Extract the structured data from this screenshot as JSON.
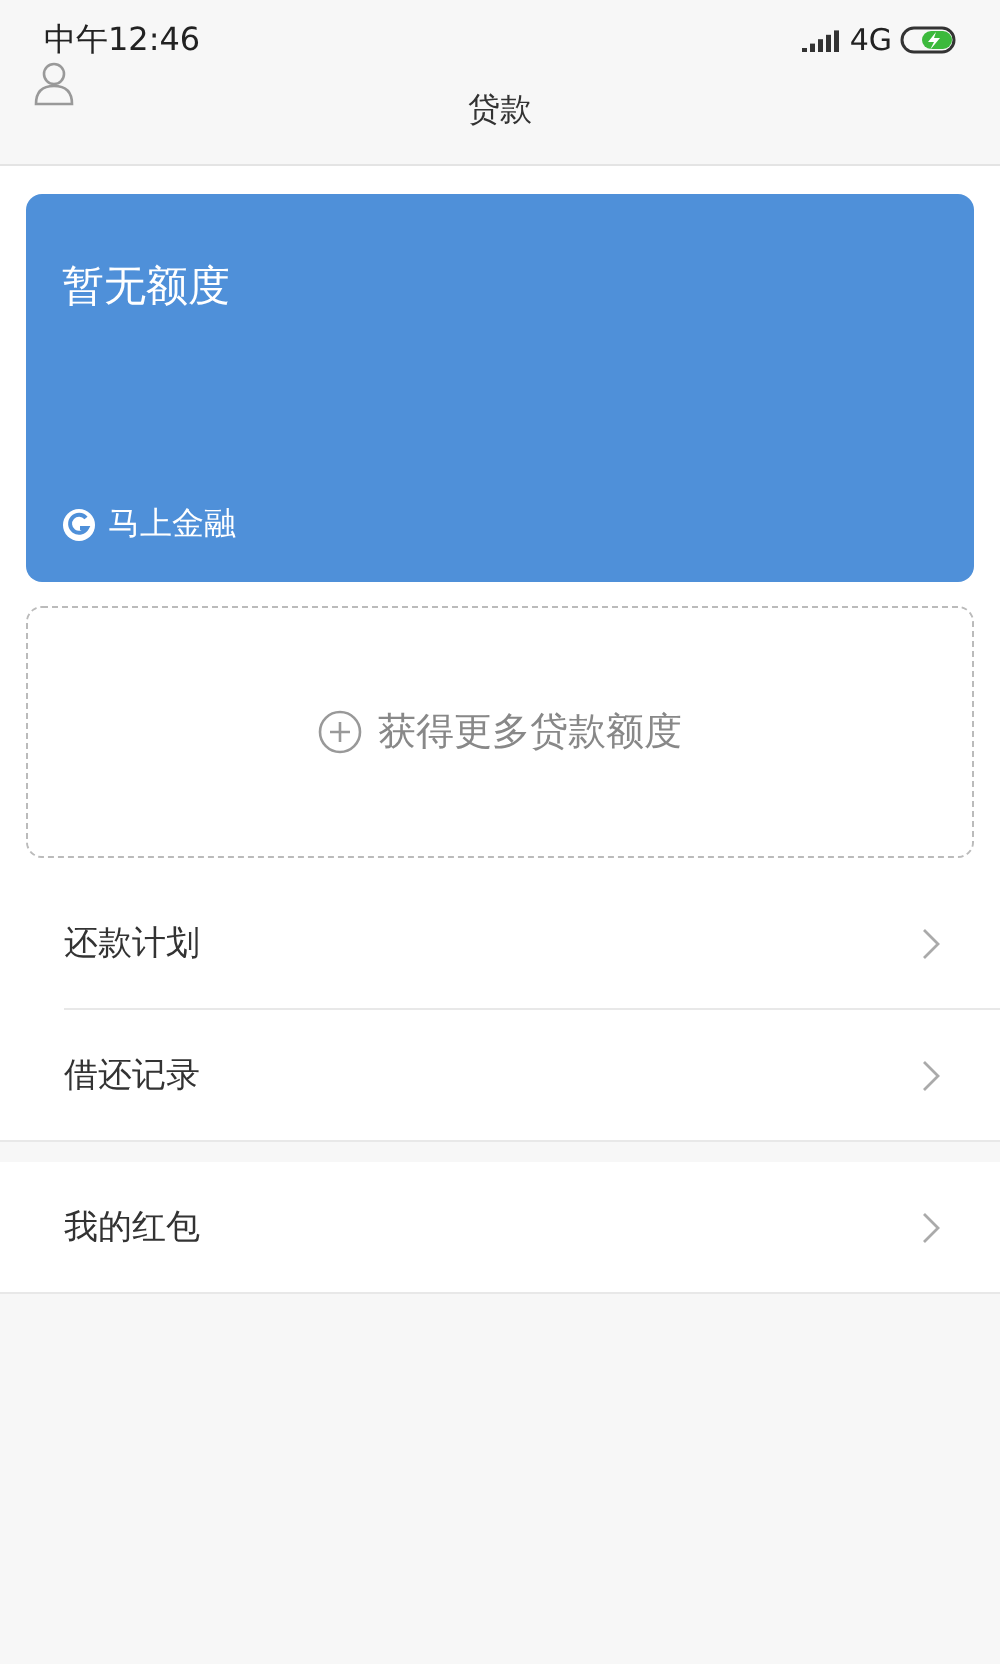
{
  "status_bar": {
    "time": "中午12:46",
    "network": "4G"
  },
  "header": {
    "title": "贷款"
  },
  "credit_card": {
    "title": "暂无额度",
    "brand": "马上金融"
  },
  "add_credit": {
    "label": "获得更多贷款额度"
  },
  "menu_groups": [
    [
      {
        "label": "还款计划"
      },
      {
        "label": "借还记录"
      }
    ],
    [
      {
        "label": "我的红包"
      }
    ]
  ]
}
